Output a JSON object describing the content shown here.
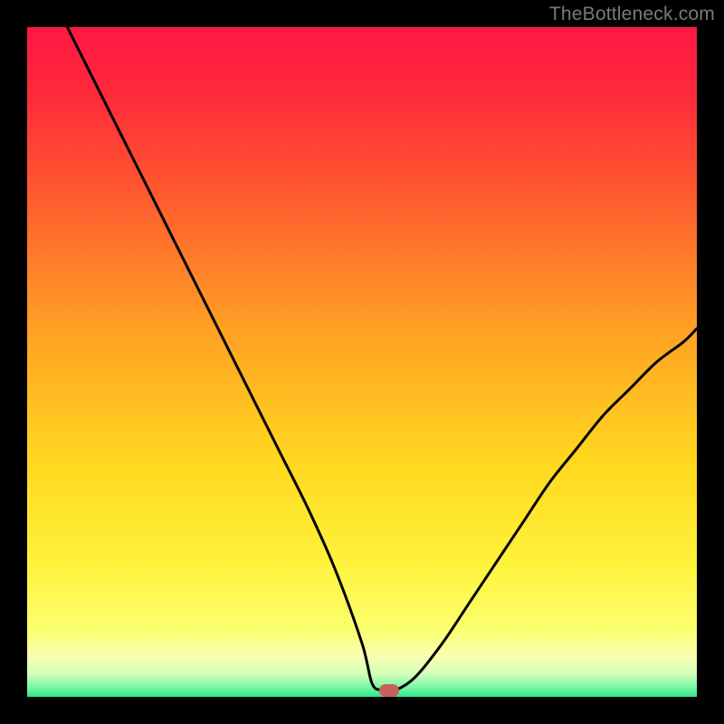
{
  "watermark": "TheBottleneck.com",
  "colors": {
    "bg": "#000000",
    "gradient_stops": [
      {
        "offset": 0.0,
        "color": "#ff1744"
      },
      {
        "offset": 0.1,
        "color": "#ff2a3a"
      },
      {
        "offset": 0.25,
        "color": "#ff5a2f"
      },
      {
        "offset": 0.45,
        "color": "#ffa024"
      },
      {
        "offset": 0.65,
        "color": "#ffd81f"
      },
      {
        "offset": 0.8,
        "color": "#fff23a"
      },
      {
        "offset": 0.9,
        "color": "#fbff70"
      },
      {
        "offset": 0.94,
        "color": "#f7ffb0"
      },
      {
        "offset": 0.965,
        "color": "#d6ffb8"
      },
      {
        "offset": 0.985,
        "color": "#7cf7a8"
      },
      {
        "offset": 1.0,
        "color": "#2fe68a"
      }
    ],
    "curve": "#000000",
    "min_marker": "#c86058"
  },
  "chart_data": {
    "type": "line",
    "title": "",
    "xlabel": "",
    "ylabel": "",
    "xlim": [
      0,
      100
    ],
    "ylim": [
      0,
      100
    ],
    "grid": false,
    "legend": false,
    "series": [
      {
        "name": "bottleneck-curve",
        "x": [
          6,
          10,
          14,
          18,
          22,
          26,
          30,
          34,
          38,
          42,
          46,
          50,
          51.5,
          53,
          55,
          58,
          62,
          66,
          70,
          74,
          78,
          82,
          86,
          90,
          94,
          98,
          100
        ],
        "y": [
          100,
          92,
          84,
          76,
          68,
          60,
          52,
          44,
          36,
          28,
          19,
          8,
          2,
          1,
          1,
          3,
          8,
          14,
          20,
          26,
          32,
          37,
          42,
          46,
          50,
          53,
          55
        ]
      }
    ],
    "min_point": {
      "x": 54,
      "y": 1
    }
  }
}
